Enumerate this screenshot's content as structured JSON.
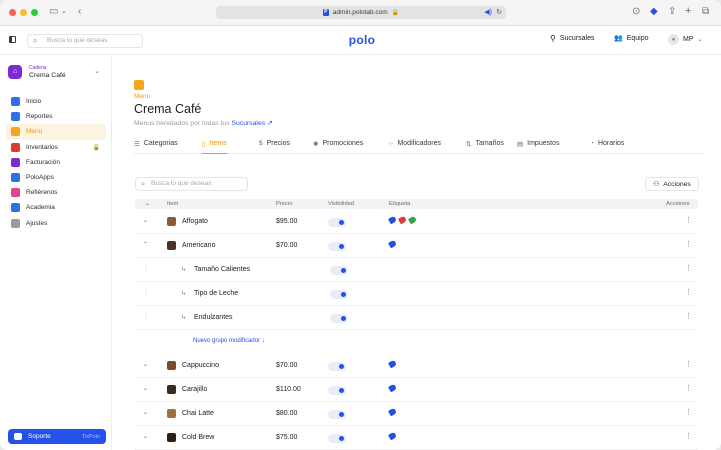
{
  "browser": {
    "url": "admin.polotab.com"
  },
  "header": {
    "search_placeholder": "Busca lo que deseas",
    "logo": "polo",
    "branches_label": "Sucursales",
    "team_label": "Equipo",
    "user_initials": "MP"
  },
  "sidebar": {
    "org_type": "Cadena",
    "org_name": "Crema Café",
    "items": [
      {
        "label": "Inicio",
        "color": "#2f6fe8",
        "icon": "home-icon"
      },
      {
        "label": "Reportes",
        "color": "#2f6fe8",
        "icon": "chart-icon"
      },
      {
        "label": "Menu",
        "color": "#f2a81d",
        "icon": "menu-icon",
        "active": true
      },
      {
        "label": "Inventarios",
        "color": "#d93a3a",
        "icon": "box-icon",
        "locked": true
      },
      {
        "label": "Facturación",
        "color": "#7a2bd6",
        "icon": "invoice-icon"
      },
      {
        "label": "PoloApps",
        "color": "#2f6fe8",
        "icon": "apps-icon"
      },
      {
        "label": "Refiérenos",
        "color": "#e0468f",
        "icon": "heart-icon"
      },
      {
        "label": "Academia",
        "color": "#2f6fe8",
        "icon": "academy-icon"
      },
      {
        "label": "Ajustes",
        "color": "#9a9aa0",
        "icon": "gear-icon"
      }
    ],
    "support_label": "Soporte",
    "support_sub": "TixPolo"
  },
  "page": {
    "crumb": "Menu",
    "title": "Crema Café",
    "subtitle": "Menus heredados por todas tus",
    "subtitle_link": "Sucursales",
    "tabs": [
      "Categorias",
      "Items",
      "Precios",
      "Promociones",
      "Modificadores",
      "Tamaños",
      "Impuestos",
      "Horarios"
    ],
    "active_tab": "Items"
  },
  "table": {
    "search_placeholder": "Busca lo que deseas",
    "actions_button": "Acciones",
    "columns": [
      "Item",
      "Precio",
      "Visibilidad",
      "Etiqueta",
      "Acciones"
    ],
    "rows": [
      {
        "name": "Affogato",
        "price": "$95.00",
        "visible": true,
        "tags": [
          "#2452e8",
          "#d93a3a",
          "#3aa14a"
        ],
        "expanded": false,
        "thumb": "#8b5a3c"
      },
      {
        "name": "Americano",
        "price": "$70.00",
        "visible": true,
        "tags": [
          "#2452e8"
        ],
        "expanded": true,
        "thumb": "#4a3226"
      },
      {
        "name": "Tamaño Calientes",
        "sub": true,
        "visible": true
      },
      {
        "name": "Tipo de Leche",
        "sub": true,
        "visible": true
      },
      {
        "name": "Endulzantes",
        "sub": true,
        "visible": true
      },
      {
        "name": "Cappuccino",
        "price": "$70.00",
        "visible": true,
        "tags": [
          "#2452e8"
        ],
        "expanded": false,
        "thumb": "#7a4a2e"
      },
      {
        "name": "Carajillo",
        "price": "$110.00",
        "visible": true,
        "tags": [
          "#2452e8"
        ],
        "expanded": false,
        "thumb": "#3a2a20"
      },
      {
        "name": "Chai Latte",
        "price": "$80.00",
        "visible": true,
        "tags": [
          "#2452e8"
        ],
        "expanded": false,
        "thumb": "#a0703a"
      },
      {
        "name": "Cold Brew",
        "price": "$75.00",
        "visible": true,
        "tags": [
          "#2452e8"
        ],
        "expanded": false,
        "thumb": "#2d2018"
      }
    ],
    "new_group_label": "Nuevo grupo modificador"
  }
}
